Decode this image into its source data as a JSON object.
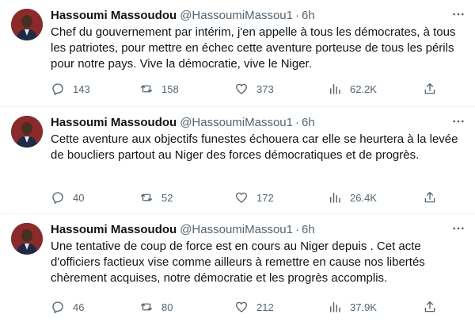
{
  "tweets": [
    {
      "name": "Hassoumi Massoudou",
      "handle": "@HassoumiMassou1",
      "separator": "·",
      "time": "6h",
      "text": "Chef du gouvernement par intérim, j'en appelle à tous les démocrates, à tous les patriotes, pour mettre en échec cette aventure porteuse de tous les périls pour notre pays. Vive la démocratie, vive le Niger.",
      "replies": "143",
      "retweets": "158",
      "likes": "373",
      "views": "62.2K"
    },
    {
      "name": "Hassoumi Massoudou",
      "handle": "@HassoumiMassou1",
      "separator": "·",
      "time": "6h",
      "text": "Cette aventure aux objectifs funestes échouera car elle se heurtera à la levée de boucliers partout au Niger des forces démocratiques et de progrès.",
      "replies": "40",
      "retweets": "52",
      "likes": "172",
      "views": "26.4K"
    },
    {
      "name": "Hassoumi Massoudou",
      "handle": "@HassoumiMassou1",
      "separator": "·",
      "time": "6h",
      "text": "Une tentative de coup de force est en cours au Niger depuis . Cet acte d'officiers factieux vise comme ailleurs à remettre en cause nos libertés chèrement acquises, notre démocratie et les progrès accomplis.",
      "replies": "46",
      "retweets": "80",
      "likes": "212",
      "views": "37.9K"
    }
  ],
  "icons": {
    "more": "more-horizontal-icon",
    "reply": "reply-icon",
    "retweet": "retweet-icon",
    "like": "heart-icon",
    "views": "views-icon",
    "share": "share-icon"
  },
  "colors": {
    "text": "#0f1419",
    "secondary": "#536471",
    "divider": "#eff3f4"
  }
}
